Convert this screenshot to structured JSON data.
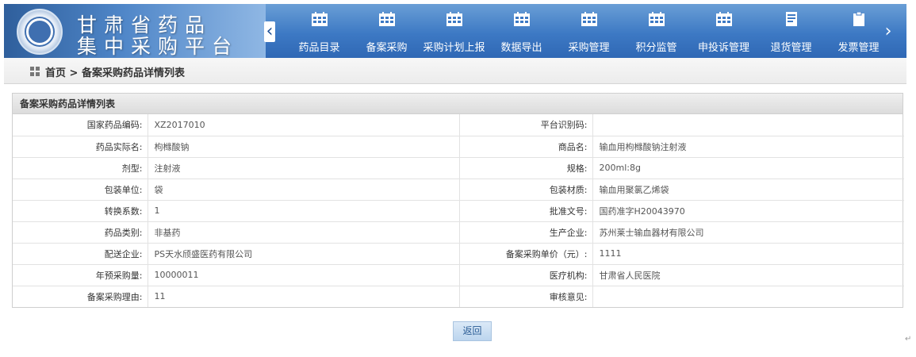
{
  "header": {
    "title_line1": "甘肃省药品",
    "title_line2": "集中采购平台",
    "emblem_icon": "province-emblem-icon",
    "prev_icon": "chevron-left-icon",
    "next_icon": "chevron-right-icon"
  },
  "nav": {
    "items": [
      {
        "label": "药品目录",
        "icon": "calendar-grid-icon"
      },
      {
        "label": "备案采购",
        "icon": "calendar-grid-icon"
      },
      {
        "label": "采购计划上报",
        "icon": "calendar-grid-icon"
      },
      {
        "label": "数据导出",
        "icon": "calendar-grid-icon"
      },
      {
        "label": "采购管理",
        "icon": "calendar-grid-icon"
      },
      {
        "label": "积分监管",
        "icon": "calendar-grid-icon"
      },
      {
        "label": "申投诉管理",
        "icon": "calendar-grid-icon"
      },
      {
        "label": "退货管理",
        "icon": "document-icon"
      },
      {
        "label": "发票管理",
        "icon": "clipboard-icon"
      }
    ]
  },
  "breadcrumb": {
    "icon": "grid-icon",
    "text": "首页 > 备案采购药品详情列表"
  },
  "panel": {
    "title": "备案采购药品详情列表",
    "rows": [
      {
        "l1": "国家药品编码:",
        "v1": "XZ2017010",
        "l2": "平台识别码:",
        "v2": ""
      },
      {
        "l1": "药品实际名:",
        "v1": "枸橼酸钠",
        "l2": "商品名:",
        "v2": "输血用枸橼酸钠注射液"
      },
      {
        "l1": "剂型:",
        "v1": "注射液",
        "l2": "规格:",
        "v2": "200ml:8g"
      },
      {
        "l1": "包装单位:",
        "v1": "袋",
        "l2": "包装材质:",
        "v2": "输血用聚氯乙烯袋"
      },
      {
        "l1": "转换系数:",
        "v1": "1",
        "l2": "批准文号:",
        "v2": "国药准字H20043970"
      },
      {
        "l1": "药品类别:",
        "v1": "非基药",
        "l2": "生产企业:",
        "v2": "苏州莱士输血器材有限公司"
      },
      {
        "l1": "配送企业:",
        "v1": "PS天水颀盛医药有限公司",
        "l2": "备案采购单价（元）:",
        "v2": "1111"
      },
      {
        "l1": "年预采购量:",
        "v1": "10000011",
        "l2": "医疗机构:",
        "v2": "甘肃省人民医院"
      },
      {
        "l1": "备案采购理由:",
        "v1": "11",
        "l2": "审核意见:",
        "v2": ""
      }
    ]
  },
  "actions": {
    "return_label": "返回"
  },
  "misc": {
    "paragraph_mark": "↵"
  }
}
